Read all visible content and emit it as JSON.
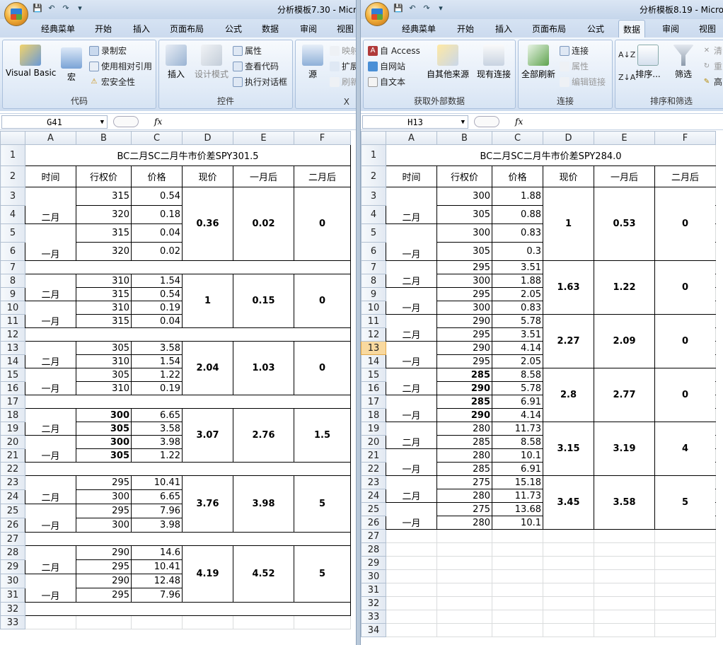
{
  "left": {
    "window_title": "分析模板7.30 - Micro",
    "tabs": [
      "经典菜单",
      "开始",
      "插入",
      "页面布局",
      "公式",
      "数据",
      "审阅",
      "视图"
    ],
    "ribbon": {
      "code_group": "代码",
      "visual_basic": "Visual Basic",
      "macro": "宏",
      "record_macro": "录制宏",
      "relative_ref": "使用相对引用",
      "macro_security": "宏安全性",
      "controls_group": "控件",
      "insert": "插入",
      "design_mode": "设计模式",
      "properties": "属性",
      "view_code": "查看代码",
      "run_dialog": "执行对话框",
      "xml_group": "X",
      "source": "源",
      "map": "映射",
      "expand": "扩展",
      "refresh": "刷新"
    },
    "name_box": "G41",
    "fx": "fx",
    "col_headers": [
      "A",
      "B",
      "C",
      "D",
      "E",
      "F"
    ],
    "sheet": {
      "title": "BC二月SC二月牛市价差SPY301.5",
      "headers": [
        "时间",
        "行权价",
        "价格",
        "现价",
        "一月后",
        "二月后"
      ],
      "blocks": [
        {
          "rows": [
            [
              "315",
              "0.54"
            ],
            [
              "320",
              "0.18"
            ],
            [
              "315",
              "0.04"
            ],
            [
              "320",
              "0.02"
            ]
          ],
          "current": "0.36",
          "m1": "0.02",
          "m2": "0"
        },
        {
          "rows": [
            [
              "310",
              "1.54"
            ],
            [
              "315",
              "0.54"
            ],
            [
              "310",
              "0.19"
            ],
            [
              "315",
              "0.04"
            ]
          ],
          "current": "1",
          "m1": "0.15",
          "m2": "0"
        },
        {
          "rows": [
            [
              "305",
              "3.58"
            ],
            [
              "310",
              "1.54"
            ],
            [
              "305",
              "1.22"
            ],
            [
              "310",
              "0.19"
            ]
          ],
          "current": "2.04",
          "m1": "1.03",
          "m2": "0"
        },
        {
          "rows": [
            [
              "300",
              "6.65"
            ],
            [
              "305",
              "3.58"
            ],
            [
              "300",
              "3.98"
            ],
            [
              "305",
              "1.22"
            ]
          ],
          "current": "3.07",
          "m1": "2.76",
          "m2": "1.5"
        },
        {
          "rows": [
            [
              "295",
              "10.41"
            ],
            [
              "300",
              "6.65"
            ],
            [
              "295",
              "7.96"
            ],
            [
              "300",
              "3.98"
            ]
          ],
          "current": "3.76",
          "m1": "3.98",
          "m2": "5"
        },
        {
          "rows": [
            [
              "290",
              "14.6"
            ],
            [
              "295",
              "10.41"
            ],
            [
              "290",
              "12.48"
            ],
            [
              "295",
              "7.96"
            ]
          ],
          "current": "4.19",
          "m1": "4.52",
          "m2": "5"
        }
      ],
      "feb": "二月",
      "jan": "一月"
    }
  },
  "right": {
    "window_title": "分析模板8.19 - Micro",
    "tabs": [
      "经典菜单",
      "开始",
      "插入",
      "页面布局",
      "公式",
      "数据",
      "审阅",
      "视图"
    ],
    "ribbon": {
      "ext_group": "获取外部数据",
      "access": "自 Access",
      "web": "自网站",
      "text": "自文本",
      "other": "自其他来源",
      "existing": "现有连接",
      "conn_group": "连接",
      "refresh_all": "全部刷新",
      "connections": "连接",
      "properties": "属性",
      "edit_links": "编辑链接",
      "sort_group": "排序和筛选",
      "sort": "排序...",
      "filter": "筛选",
      "clear": "清",
      "reapply": "重",
      "advanced": "高"
    },
    "name_box": "H13",
    "fx": "fx",
    "col_headers": [
      "A",
      "B",
      "C",
      "D",
      "E",
      "F"
    ],
    "sheet": {
      "title": "BC二月SC二月牛市价差SPY284.0",
      "headers": [
        "时间",
        "行权价",
        "价格",
        "现价",
        "一月后",
        "二月后"
      ],
      "blocks": [
        {
          "rows": [
            [
              "300",
              "1.88"
            ],
            [
              "305",
              "0.88"
            ],
            [
              "300",
              "0.83"
            ],
            [
              "305",
              "0.3"
            ]
          ],
          "current": "1",
          "m1": "0.53",
          "m2": "0"
        },
        {
          "rows": [
            [
              "295",
              "3.51"
            ],
            [
              "300",
              "1.88"
            ],
            [
              "295",
              "2.05"
            ],
            [
              "300",
              "0.83"
            ]
          ],
          "current": "1.63",
          "m1": "1.22",
          "m2": "0"
        },
        {
          "rows": [
            [
              "290",
              "5.78"
            ],
            [
              "295",
              "3.51"
            ],
            [
              "290",
              "4.14"
            ],
            [
              "295",
              "2.05"
            ]
          ],
          "current": "2.27",
          "m1": "2.09",
          "m2": "0"
        },
        {
          "rows": [
            [
              "285",
              "8.58"
            ],
            [
              "290",
              "5.78"
            ],
            [
              "285",
              "6.91"
            ],
            [
              "290",
              "4.14"
            ]
          ],
          "current": "2.8",
          "m1": "2.77",
          "m2": "0"
        },
        {
          "rows": [
            [
              "280",
              "11.73"
            ],
            [
              "285",
              "8.58"
            ],
            [
              "280",
              "10.1"
            ],
            [
              "285",
              "6.91"
            ]
          ],
          "current": "3.15",
          "m1": "3.19",
          "m2": "4"
        },
        {
          "rows": [
            [
              "275",
              "15.18"
            ],
            [
              "280",
              "11.73"
            ],
            [
              "275",
              "13.68"
            ],
            [
              "280",
              "10.1"
            ]
          ],
          "current": "3.45",
          "m1": "3.58",
          "m2": "5"
        }
      ],
      "feb": "二月",
      "jan": "一月"
    }
  }
}
